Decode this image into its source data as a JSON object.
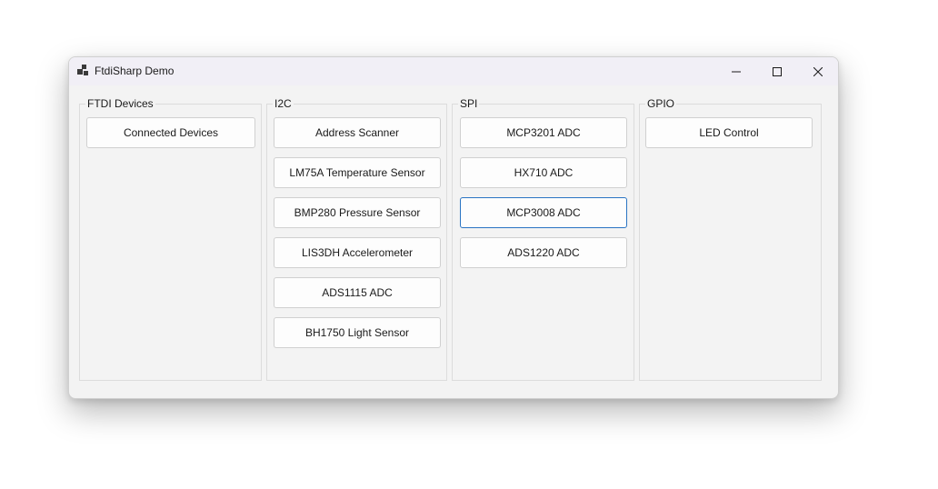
{
  "window": {
    "title": "FtdiSharp Demo"
  },
  "groups": [
    {
      "label": "FTDI Devices",
      "buttons": [
        "Connected Devices"
      ]
    },
    {
      "label": "I2C",
      "buttons": [
        "Address Scanner",
        "LM75A Temperature Sensor",
        "BMP280 Pressure Sensor",
        "LIS3DH Accelerometer",
        "ADS1115 ADC",
        "BH1750 Light Sensor"
      ]
    },
    {
      "label": "SPI",
      "buttons": [
        "MCP3201 ADC",
        "HX710 ADC",
        "MCP3008 ADC",
        "ADS1220 ADC"
      ]
    },
    {
      "label": "GPIO",
      "buttons": [
        "LED Control"
      ]
    }
  ],
  "colors": {
    "focus_border": "#2a74c3",
    "titlebar_bg": "#f1eff6"
  },
  "icons": {
    "app": "app-icon",
    "minimize": "minimize-icon",
    "maximize": "maximize-icon",
    "close": "close-icon"
  }
}
